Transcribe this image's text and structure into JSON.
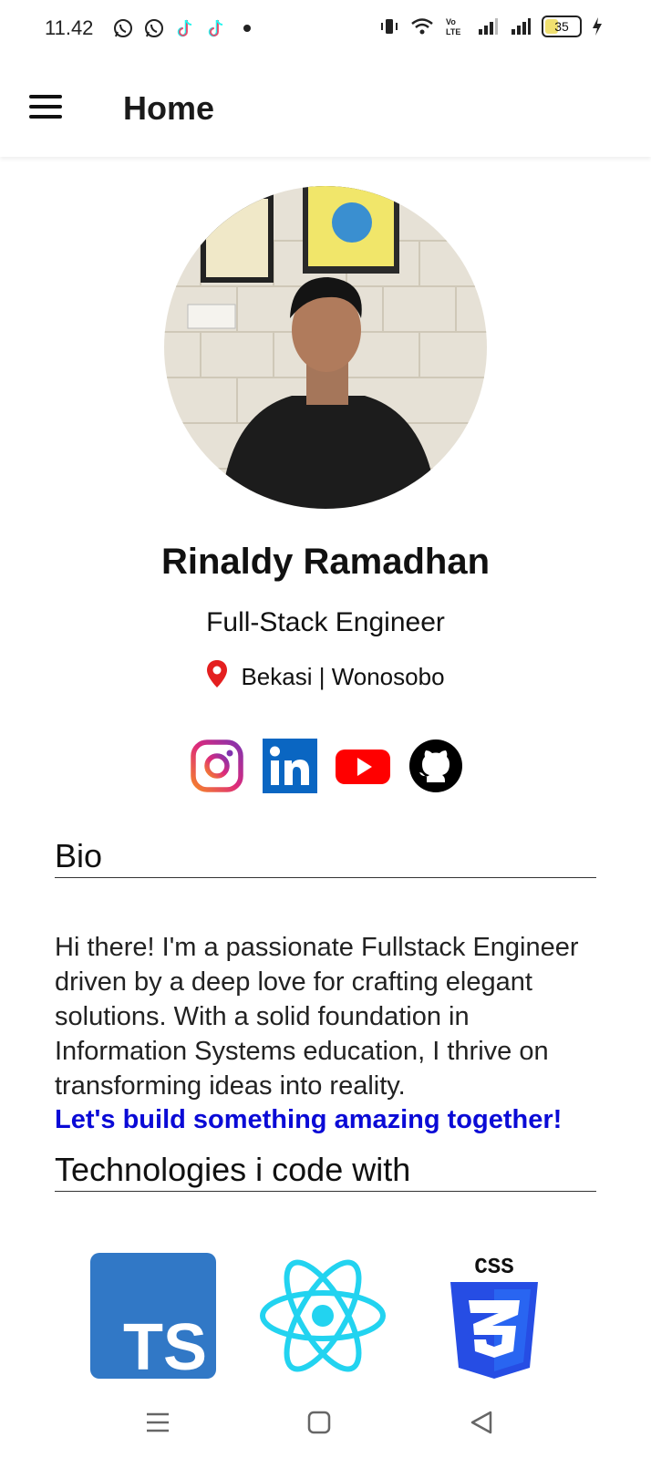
{
  "status_bar": {
    "time": "11.42",
    "battery_level": "35",
    "left_icons": [
      "whatsapp-icon",
      "whatsapp-icon",
      "tiktok-icon",
      "tiktok-icon",
      "notification-dot-icon"
    ],
    "right_icons": [
      "vibrate-icon",
      "wifi-icon",
      "volte-icon",
      "signal-icon",
      "signal-icon",
      "battery-icon",
      "charging-icon"
    ]
  },
  "app_bar": {
    "title": "Home"
  },
  "profile": {
    "name": "Rinaldy Ramadhan",
    "role": "Full-Stack Engineer",
    "location": "Bekasi | Wonosobo"
  },
  "socials": [
    "instagram-icon",
    "linkedin-icon",
    "youtube-icon",
    "github-icon"
  ],
  "bio": {
    "heading": "Bio",
    "text": "Hi there! I'm a passionate Fullstack Engineer driven by a deep love for crafting elegant solutions. With a solid foundation in Information Systems education, I thrive on transforming ideas into reality.",
    "cta": "Let's build something amazing together!"
  },
  "technologies": {
    "heading": "Technologies i code with",
    "items": [
      "typescript-logo",
      "react-logo",
      "css3-logo"
    ],
    "ts_label": "TS",
    "css_label": "CSS"
  },
  "colors": {
    "cta": "#0a0ad6",
    "location_pin": "#e41f1f",
    "instagram": "#8a2be2",
    "linkedin": "#0a66c2",
    "youtube": "#ff0000",
    "typescript": "#3178c6",
    "react": "#22d3f0",
    "css3": "#264de4"
  }
}
